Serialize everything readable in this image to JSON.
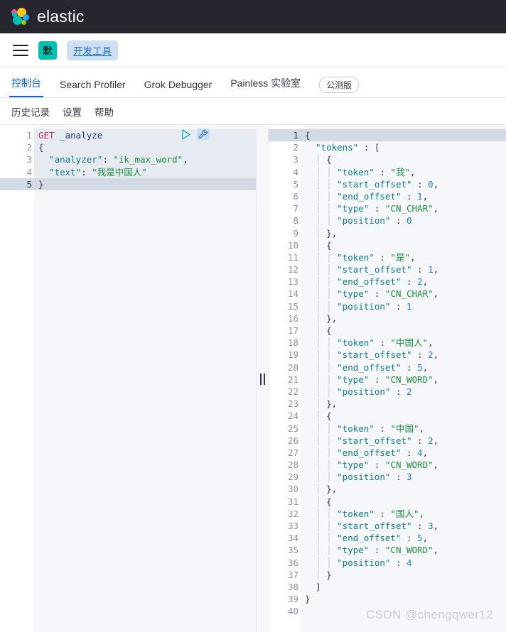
{
  "header": {
    "brand": "elastic",
    "logo_colors": {
      "pink": "#f04e98",
      "yellow": "#fec514",
      "blue": "#1ba9f5",
      "teal": "#00bfb3",
      "green": "#93c90e"
    },
    "background": "#25262e"
  },
  "nav": {
    "menu_icon": "hamburger-icon",
    "space_badge": "默",
    "breadcrumb": "开发工具"
  },
  "tabs": [
    {
      "label": "控制台",
      "active": true
    },
    {
      "label": "Search Profiler",
      "active": false
    },
    {
      "label": "Grok Debugger",
      "active": false
    },
    {
      "label": "Painless 实验室",
      "active": false
    }
  ],
  "beta_pill": "公测版",
  "submenu": [
    {
      "label": "历史记录"
    },
    {
      "label": "设置"
    },
    {
      "label": "帮助"
    }
  ],
  "accent": "#0b64dd",
  "request_editor": {
    "play_icon": "play-icon",
    "wrench_icon": "wrench-icon",
    "lines": [
      {
        "n": "1",
        "fold": "",
        "cur": false,
        "sel": true,
        "tokens": [
          {
            "t": "method",
            "v": "GET"
          },
          {
            "t": "punct",
            "v": " "
          },
          {
            "t": "url",
            "v": "_analyze"
          }
        ]
      },
      {
        "n": "2",
        "fold": "▾",
        "cur": false,
        "sel": true,
        "tokens": [
          {
            "t": "brace",
            "v": "{"
          }
        ]
      },
      {
        "n": "3",
        "fold": "",
        "cur": false,
        "sel": true,
        "tokens": [
          {
            "t": "key",
            "v": "  \"analyzer\""
          },
          {
            "t": "punct",
            "v": ": "
          },
          {
            "t": "str",
            "v": "\"ik_max_word\""
          },
          {
            "t": "punct",
            "v": ","
          }
        ]
      },
      {
        "n": "4",
        "fold": "",
        "cur": false,
        "sel": true,
        "tokens": [
          {
            "t": "key",
            "v": "  \"text\""
          },
          {
            "t": "punct",
            "v": ": "
          },
          {
            "t": "str",
            "v": "\"我是中国人\""
          }
        ]
      },
      {
        "n": "5",
        "fold": "▴",
        "cur": true,
        "sel": false,
        "tokens": [
          {
            "t": "brace",
            "v": "}"
          }
        ]
      }
    ]
  },
  "response_editor": {
    "lines": [
      {
        "n": "1",
        "fold": "▾",
        "cur": true,
        "tokens": [
          {
            "t": "brace",
            "v": "{"
          }
        ]
      },
      {
        "n": "2",
        "fold": "▾",
        "cur": false,
        "tokens": [
          {
            "t": "key",
            "v": "  \"tokens\""
          },
          {
            "t": "punct",
            "v": " : "
          },
          {
            "t": "brace",
            "v": "["
          }
        ]
      },
      {
        "n": "3",
        "fold": "▾",
        "cur": false,
        "tokens": [
          {
            "t": "guide",
            "v": "  │ "
          },
          {
            "t": "brace",
            "v": "{"
          }
        ]
      },
      {
        "n": "4",
        "fold": "",
        "cur": false,
        "tokens": [
          {
            "t": "guide",
            "v": "  │ │ "
          },
          {
            "t": "key",
            "v": "\"token\""
          },
          {
            "t": "punct",
            "v": " : "
          },
          {
            "t": "str",
            "v": "\"我\""
          },
          {
            "t": "punct",
            "v": ","
          }
        ]
      },
      {
        "n": "5",
        "fold": "",
        "cur": false,
        "tokens": [
          {
            "t": "guide",
            "v": "  │ │ "
          },
          {
            "t": "key",
            "v": "\"start_offset\""
          },
          {
            "t": "punct",
            "v": " : "
          },
          {
            "t": "num",
            "v": "0"
          },
          {
            "t": "punct",
            "v": ","
          }
        ]
      },
      {
        "n": "6",
        "fold": "",
        "cur": false,
        "tokens": [
          {
            "t": "guide",
            "v": "  │ │ "
          },
          {
            "t": "key",
            "v": "\"end_offset\""
          },
          {
            "t": "punct",
            "v": " : "
          },
          {
            "t": "num",
            "v": "1"
          },
          {
            "t": "punct",
            "v": ","
          }
        ]
      },
      {
        "n": "7",
        "fold": "",
        "cur": false,
        "tokens": [
          {
            "t": "guide",
            "v": "  │ │ "
          },
          {
            "t": "key",
            "v": "\"type\""
          },
          {
            "t": "punct",
            "v": " : "
          },
          {
            "t": "str",
            "v": "\"CN_CHAR\""
          },
          {
            "t": "punct",
            "v": ","
          }
        ]
      },
      {
        "n": "8",
        "fold": "",
        "cur": false,
        "tokens": [
          {
            "t": "guide",
            "v": "  │ │ "
          },
          {
            "t": "key",
            "v": "\"position\""
          },
          {
            "t": "punct",
            "v": " : "
          },
          {
            "t": "num",
            "v": "0"
          }
        ]
      },
      {
        "n": "9",
        "fold": "▴",
        "cur": false,
        "tokens": [
          {
            "t": "guide",
            "v": "  │ "
          },
          {
            "t": "brace",
            "v": "},"
          }
        ]
      },
      {
        "n": "10",
        "fold": "▾",
        "cur": false,
        "tokens": [
          {
            "t": "guide",
            "v": "  │ "
          },
          {
            "t": "brace",
            "v": "{"
          }
        ]
      },
      {
        "n": "11",
        "fold": "",
        "cur": false,
        "tokens": [
          {
            "t": "guide",
            "v": "  │ │ "
          },
          {
            "t": "key",
            "v": "\"token\""
          },
          {
            "t": "punct",
            "v": " : "
          },
          {
            "t": "str",
            "v": "\"是\""
          },
          {
            "t": "punct",
            "v": ","
          }
        ]
      },
      {
        "n": "12",
        "fold": "",
        "cur": false,
        "tokens": [
          {
            "t": "guide",
            "v": "  │ │ "
          },
          {
            "t": "key",
            "v": "\"start_offset\""
          },
          {
            "t": "punct",
            "v": " : "
          },
          {
            "t": "num",
            "v": "1"
          },
          {
            "t": "punct",
            "v": ","
          }
        ]
      },
      {
        "n": "13",
        "fold": "",
        "cur": false,
        "tokens": [
          {
            "t": "guide",
            "v": "  │ │ "
          },
          {
            "t": "key",
            "v": "\"end_offset\""
          },
          {
            "t": "punct",
            "v": " : "
          },
          {
            "t": "num",
            "v": "2"
          },
          {
            "t": "punct",
            "v": ","
          }
        ]
      },
      {
        "n": "14",
        "fold": "",
        "cur": false,
        "tokens": [
          {
            "t": "guide",
            "v": "  │ │ "
          },
          {
            "t": "key",
            "v": "\"type\""
          },
          {
            "t": "punct",
            "v": " : "
          },
          {
            "t": "str",
            "v": "\"CN_CHAR\""
          },
          {
            "t": "punct",
            "v": ","
          }
        ]
      },
      {
        "n": "15",
        "fold": "",
        "cur": false,
        "tokens": [
          {
            "t": "guide",
            "v": "  │ │ "
          },
          {
            "t": "key",
            "v": "\"position\""
          },
          {
            "t": "punct",
            "v": " : "
          },
          {
            "t": "num",
            "v": "1"
          }
        ]
      },
      {
        "n": "16",
        "fold": "▴",
        "cur": false,
        "tokens": [
          {
            "t": "guide",
            "v": "  │ "
          },
          {
            "t": "brace",
            "v": "},"
          }
        ]
      },
      {
        "n": "17",
        "fold": "▾",
        "cur": false,
        "tokens": [
          {
            "t": "guide",
            "v": "  │ "
          },
          {
            "t": "brace",
            "v": "{"
          }
        ]
      },
      {
        "n": "18",
        "fold": "",
        "cur": false,
        "tokens": [
          {
            "t": "guide",
            "v": "  │ │ "
          },
          {
            "t": "key",
            "v": "\"token\""
          },
          {
            "t": "punct",
            "v": " : "
          },
          {
            "t": "str",
            "v": "\"中国人\""
          },
          {
            "t": "punct",
            "v": ","
          }
        ]
      },
      {
        "n": "19",
        "fold": "",
        "cur": false,
        "tokens": [
          {
            "t": "guide",
            "v": "  │ │ "
          },
          {
            "t": "key",
            "v": "\"start_offset\""
          },
          {
            "t": "punct",
            "v": " : "
          },
          {
            "t": "num",
            "v": "2"
          },
          {
            "t": "punct",
            "v": ","
          }
        ]
      },
      {
        "n": "20",
        "fold": "",
        "cur": false,
        "tokens": [
          {
            "t": "guide",
            "v": "  │ │ "
          },
          {
            "t": "key",
            "v": "\"end_offset\""
          },
          {
            "t": "punct",
            "v": " : "
          },
          {
            "t": "num",
            "v": "5"
          },
          {
            "t": "punct",
            "v": ","
          }
        ]
      },
      {
        "n": "21",
        "fold": "",
        "cur": false,
        "tokens": [
          {
            "t": "guide",
            "v": "  │ │ "
          },
          {
            "t": "key",
            "v": "\"type\""
          },
          {
            "t": "punct",
            "v": " : "
          },
          {
            "t": "str",
            "v": "\"CN_WORD\""
          },
          {
            "t": "punct",
            "v": ","
          }
        ]
      },
      {
        "n": "22",
        "fold": "",
        "cur": false,
        "tokens": [
          {
            "t": "guide",
            "v": "  │ │ "
          },
          {
            "t": "key",
            "v": "\"position\""
          },
          {
            "t": "punct",
            "v": " : "
          },
          {
            "t": "num",
            "v": "2"
          }
        ]
      },
      {
        "n": "23",
        "fold": "▴",
        "cur": false,
        "tokens": [
          {
            "t": "guide",
            "v": "  │ "
          },
          {
            "t": "brace",
            "v": "},"
          }
        ]
      },
      {
        "n": "24",
        "fold": "▾",
        "cur": false,
        "tokens": [
          {
            "t": "guide",
            "v": "  │ "
          },
          {
            "t": "brace",
            "v": "{"
          }
        ]
      },
      {
        "n": "25",
        "fold": "",
        "cur": false,
        "tokens": [
          {
            "t": "guide",
            "v": "  │ │ "
          },
          {
            "t": "key",
            "v": "\"token\""
          },
          {
            "t": "punct",
            "v": " : "
          },
          {
            "t": "str",
            "v": "\"中国\""
          },
          {
            "t": "punct",
            "v": ","
          }
        ]
      },
      {
        "n": "26",
        "fold": "",
        "cur": false,
        "tokens": [
          {
            "t": "guide",
            "v": "  │ │ "
          },
          {
            "t": "key",
            "v": "\"start_offset\""
          },
          {
            "t": "punct",
            "v": " : "
          },
          {
            "t": "num",
            "v": "2"
          },
          {
            "t": "punct",
            "v": ","
          }
        ]
      },
      {
        "n": "27",
        "fold": "",
        "cur": false,
        "tokens": [
          {
            "t": "guide",
            "v": "  │ │ "
          },
          {
            "t": "key",
            "v": "\"end_offset\""
          },
          {
            "t": "punct",
            "v": " : "
          },
          {
            "t": "num",
            "v": "4"
          },
          {
            "t": "punct",
            "v": ","
          }
        ]
      },
      {
        "n": "28",
        "fold": "",
        "cur": false,
        "tokens": [
          {
            "t": "guide",
            "v": "  │ │ "
          },
          {
            "t": "key",
            "v": "\"type\""
          },
          {
            "t": "punct",
            "v": " : "
          },
          {
            "t": "str",
            "v": "\"CN_WORD\""
          },
          {
            "t": "punct",
            "v": ","
          }
        ]
      },
      {
        "n": "29",
        "fold": "",
        "cur": false,
        "tokens": [
          {
            "t": "guide",
            "v": "  │ │ "
          },
          {
            "t": "key",
            "v": "\"position\""
          },
          {
            "t": "punct",
            "v": " : "
          },
          {
            "t": "num",
            "v": "3"
          }
        ]
      },
      {
        "n": "30",
        "fold": "▴",
        "cur": false,
        "tokens": [
          {
            "t": "guide",
            "v": "  │ "
          },
          {
            "t": "brace",
            "v": "},"
          }
        ]
      },
      {
        "n": "31",
        "fold": "▾",
        "cur": false,
        "tokens": [
          {
            "t": "guide",
            "v": "  │ "
          },
          {
            "t": "brace",
            "v": "{"
          }
        ]
      },
      {
        "n": "32",
        "fold": "",
        "cur": false,
        "tokens": [
          {
            "t": "guide",
            "v": "  │ │ "
          },
          {
            "t": "key",
            "v": "\"token\""
          },
          {
            "t": "punct",
            "v": " : "
          },
          {
            "t": "str",
            "v": "\"国人\""
          },
          {
            "t": "punct",
            "v": ","
          }
        ]
      },
      {
        "n": "33",
        "fold": "",
        "cur": false,
        "tokens": [
          {
            "t": "guide",
            "v": "  │ │ "
          },
          {
            "t": "key",
            "v": "\"start_offset\""
          },
          {
            "t": "punct",
            "v": " : "
          },
          {
            "t": "num",
            "v": "3"
          },
          {
            "t": "punct",
            "v": ","
          }
        ]
      },
      {
        "n": "34",
        "fold": "",
        "cur": false,
        "tokens": [
          {
            "t": "guide",
            "v": "  │ │ "
          },
          {
            "t": "key",
            "v": "\"end_offset\""
          },
          {
            "t": "punct",
            "v": " : "
          },
          {
            "t": "num",
            "v": "5"
          },
          {
            "t": "punct",
            "v": ","
          }
        ]
      },
      {
        "n": "35",
        "fold": "",
        "cur": false,
        "tokens": [
          {
            "t": "guide",
            "v": "  │ │ "
          },
          {
            "t": "key",
            "v": "\"type\""
          },
          {
            "t": "punct",
            "v": " : "
          },
          {
            "t": "str",
            "v": "\"CN_WORD\""
          },
          {
            "t": "punct",
            "v": ","
          }
        ]
      },
      {
        "n": "36",
        "fold": "",
        "cur": false,
        "tokens": [
          {
            "t": "guide",
            "v": "  │ │ "
          },
          {
            "t": "key",
            "v": "\"position\""
          },
          {
            "t": "punct",
            "v": " : "
          },
          {
            "t": "num",
            "v": "4"
          }
        ]
      },
      {
        "n": "37",
        "fold": "▴",
        "cur": false,
        "tokens": [
          {
            "t": "guide",
            "v": "  │ "
          },
          {
            "t": "brace",
            "v": "}"
          }
        ]
      },
      {
        "n": "38",
        "fold": "▴",
        "cur": false,
        "tokens": [
          {
            "t": "brace",
            "v": "  ]"
          }
        ]
      },
      {
        "n": "39",
        "fold": "▴",
        "cur": false,
        "tokens": [
          {
            "t": "brace",
            "v": "}"
          }
        ]
      },
      {
        "n": "40",
        "fold": "",
        "cur": false,
        "tokens": []
      }
    ]
  },
  "watermark": "CSDN @chengqwer12"
}
